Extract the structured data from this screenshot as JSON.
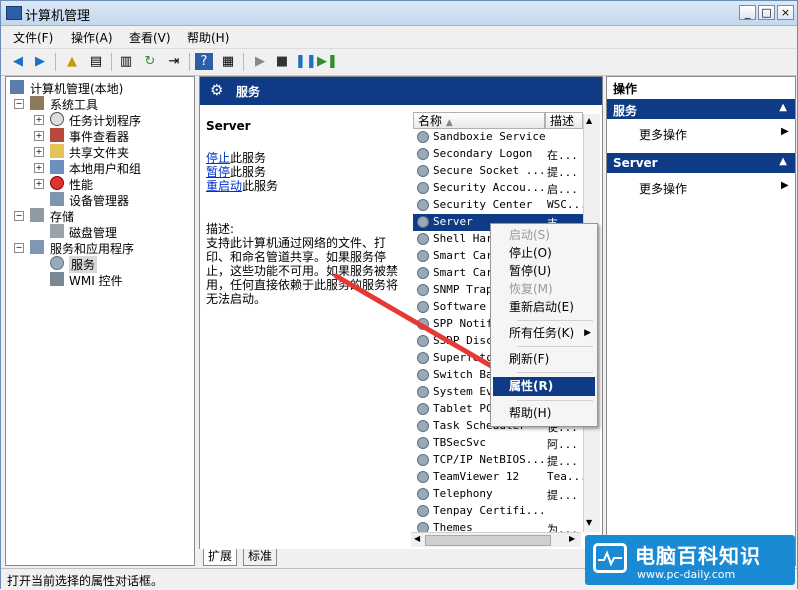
{
  "window": {
    "title": "计算机管理",
    "controls": [
      "_",
      "□",
      "×"
    ]
  },
  "menu": [
    "文件(F)",
    "操作(A)",
    "查看(V)",
    "帮助(H)"
  ],
  "tree": {
    "root": "计算机管理(本地)",
    "items": [
      {
        "label": "系统工具",
        "level": 1,
        "expand": "−"
      },
      {
        "label": "任务计划程序",
        "level": 2,
        "expand": "+"
      },
      {
        "label": "事件查看器",
        "level": 2,
        "expand": "+"
      },
      {
        "label": "共享文件夹",
        "level": 2,
        "expand": "+"
      },
      {
        "label": "本地用户和组",
        "level": 2,
        "expand": "+"
      },
      {
        "label": "性能",
        "level": 2,
        "expand": "+"
      },
      {
        "label": "设备管理器",
        "level": 2,
        "expand": ""
      },
      {
        "label": "存储",
        "level": 1,
        "expand": "−"
      },
      {
        "label": "磁盘管理",
        "level": 2,
        "expand": ""
      },
      {
        "label": "服务和应用程序",
        "level": 1,
        "expand": "−"
      },
      {
        "label": "服务",
        "level": 2,
        "expand": ""
      },
      {
        "label": "WMI 控件",
        "level": 2,
        "expand": ""
      }
    ]
  },
  "center": {
    "header": "服务",
    "selected_service": "Server",
    "links": [
      {
        "link": "停止",
        "rest": "此服务"
      },
      {
        "link": "暂停",
        "rest": "此服务"
      },
      {
        "link": "重启动",
        "rest": "此服务"
      }
    ],
    "desc_label": "描述:",
    "desc_lines": [
      "支持此计算机通过网络的文件、打",
      "印、和命名管道共享。如果服务停",
      "止，这些功能不可用。如果服务被禁",
      "用，任何直接依赖于此服务的服务将",
      "无法启动。"
    ],
    "columns": {
      "name": "名称",
      "desc": "描述"
    },
    "services": [
      {
        "name": "Sandboxie Service",
        "desc": ""
      },
      {
        "name": "Secondary Logon",
        "desc": "在..."
      },
      {
        "name": "Secure Socket ...",
        "desc": "提..."
      },
      {
        "name": "Security Accou...",
        "desc": "启..."
      },
      {
        "name": "Security Center",
        "desc": "WSC..."
      },
      {
        "name": "Server",
        "desc": "支..."
      },
      {
        "name": "Shell Hard",
        "desc": ""
      },
      {
        "name": "Smart Card",
        "desc": ""
      },
      {
        "name": "Smart Card",
        "desc": ""
      },
      {
        "name": "SNMP Trap",
        "desc": ""
      },
      {
        "name": "Software P",
        "desc": ""
      },
      {
        "name": "SPP Notifi",
        "desc": ""
      },
      {
        "name": "SSDP Disco",
        "desc": ""
      },
      {
        "name": "Superfetch",
        "desc": ""
      },
      {
        "name": "Switch Ban",
        "desc": ""
      },
      {
        "name": "System Eve",
        "desc": ""
      },
      {
        "name": "Tablet PC",
        "desc": ""
      },
      {
        "name": "Task Scheduler",
        "desc": "使..."
      },
      {
        "name": "TBSecSvc",
        "desc": "阿..."
      },
      {
        "name": "TCP/IP NetBIOS...",
        "desc": "提..."
      },
      {
        "name": "TeamViewer 12",
        "desc": "Tea..."
      },
      {
        "name": "Telephony",
        "desc": "提..."
      },
      {
        "name": "Tenpay Certifi...",
        "desc": ""
      },
      {
        "name": "Themes",
        "desc": "为..."
      }
    ],
    "tabs": [
      "扩展",
      "标准"
    ]
  },
  "context_menu": [
    {
      "label": "启动(S)",
      "disabled": true
    },
    {
      "label": "停止(O)",
      "disabled": false
    },
    {
      "label": "暂停(U)",
      "disabled": false
    },
    {
      "label": "恢复(M)",
      "disabled": true
    },
    {
      "label": "重新启动(E)",
      "disabled": false
    },
    {
      "label": "所有任务(K)",
      "disabled": false,
      "submenu": true
    },
    {
      "label": "刷新(F)",
      "disabled": false
    },
    {
      "label": "属性(R)",
      "disabled": false,
      "highlighted": true
    },
    {
      "label": "帮助(H)",
      "disabled": false
    }
  ],
  "actions": {
    "title": "操作",
    "sections": [
      {
        "header": "服务",
        "item": "更多操作"
      },
      {
        "header": "Server",
        "item": "更多操作"
      }
    ]
  },
  "status": "打开当前选择的属性对话框。",
  "logo": {
    "name": "电脑百科知识",
    "url": "www.pc-daily.com"
  },
  "colors": {
    "header_bg": "#0f3b86",
    "highlight": "#0f3b86",
    "arrow": "#e53935",
    "logo_bg": "#1a8ad4"
  }
}
